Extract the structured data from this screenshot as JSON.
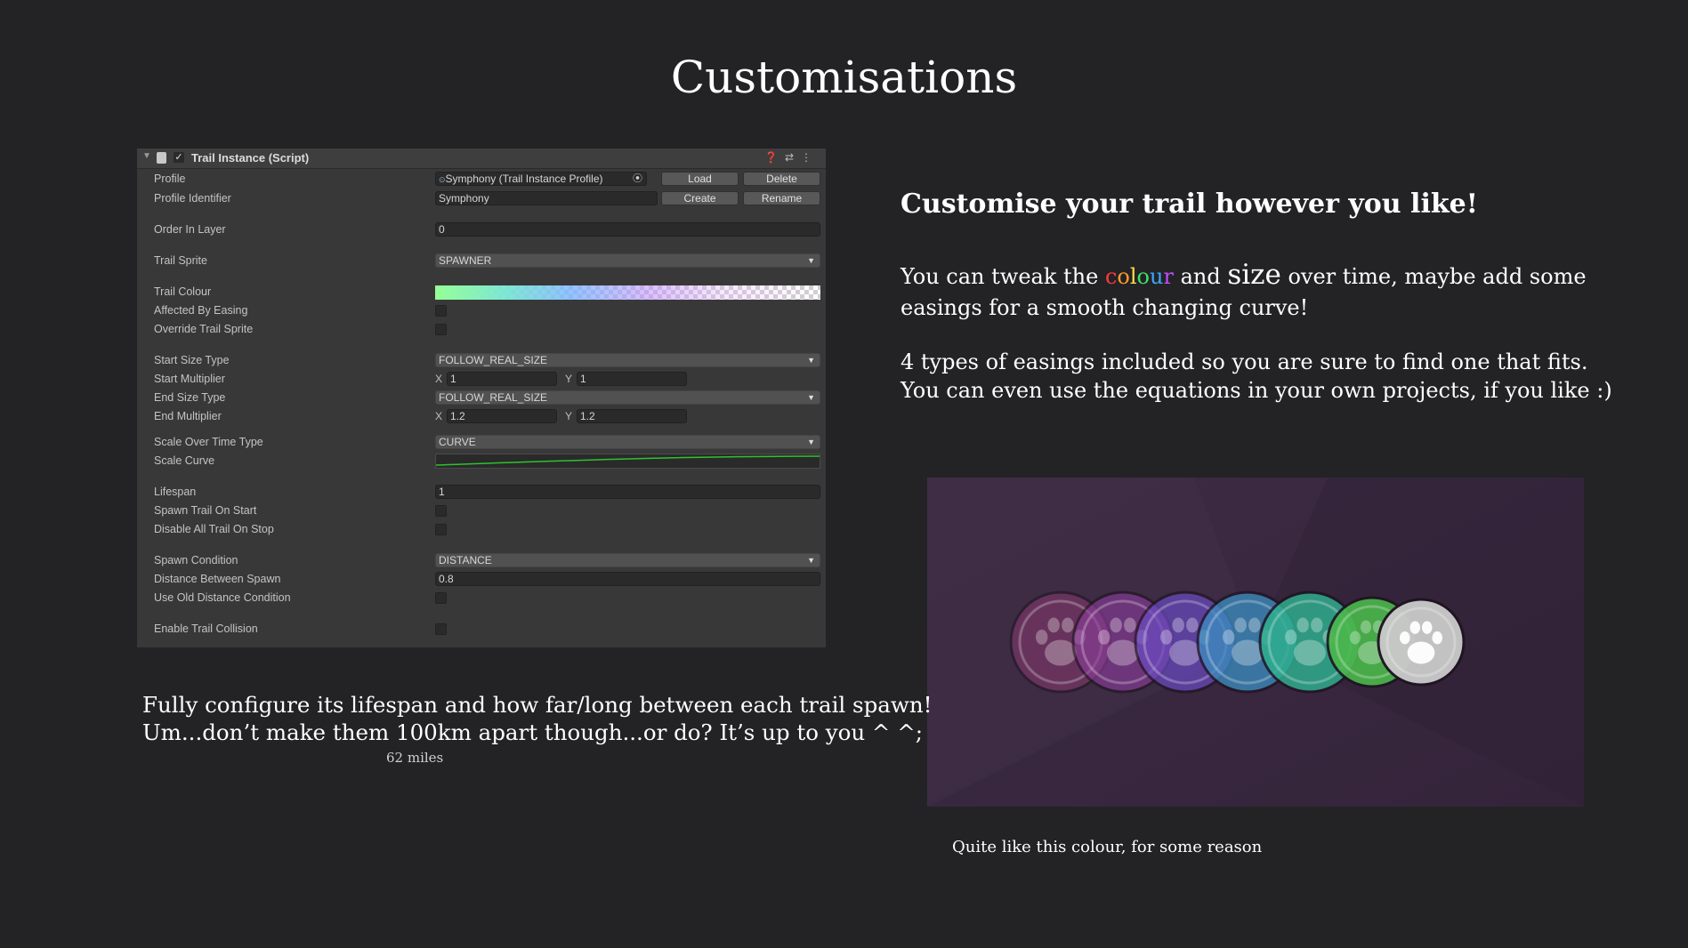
{
  "page": {
    "title": "Customisations"
  },
  "inspector": {
    "header": {
      "title": "Trail Instance (Script)"
    },
    "profile": {
      "label": "Profile",
      "value": "Symphony (Trail Instance Profile)",
      "load": "Load",
      "delete": "Delete"
    },
    "profile_identifier": {
      "label": "Profile Identifier",
      "value": "Symphony",
      "create": "Create",
      "rename": "Rename"
    },
    "order_in_layer": {
      "label": "Order In Layer",
      "value": "0"
    },
    "trail_sprite": {
      "label": "Trail Sprite",
      "value": "SPAWNER"
    },
    "trail_colour": {
      "label": "Trail Colour"
    },
    "affected_by_easing": {
      "label": "Affected By Easing"
    },
    "override_trail_sprite": {
      "label": "Override Trail Sprite"
    },
    "start_size_type": {
      "label": "Start Size Type",
      "value": "FOLLOW_REAL_SIZE"
    },
    "start_multiplier": {
      "label": "Start Multiplier",
      "x_label": "X",
      "x": "1",
      "y_label": "Y",
      "y": "1"
    },
    "end_size_type": {
      "label": "End Size Type",
      "value": "FOLLOW_REAL_SIZE"
    },
    "end_multiplier": {
      "label": "End Multiplier",
      "x_label": "X",
      "x": "1.2",
      "y_label": "Y",
      "y": "1.2"
    },
    "scale_over_time_type": {
      "label": "Scale Over Time Type",
      "value": "CURVE"
    },
    "scale_curve": {
      "label": "Scale Curve",
      "curve_color": "#2ec22e"
    },
    "lifespan": {
      "label": "Lifespan",
      "value": "1"
    },
    "spawn_trail_on_start": {
      "label": "Spawn Trail On Start"
    },
    "disable_all_trail_on_stop": {
      "label": "Disable All Trail On Stop"
    },
    "spawn_condition": {
      "label": "Spawn Condition",
      "value": "DISTANCE"
    },
    "distance_between_spawn": {
      "label": "Distance Between Spawn",
      "value": "0.8"
    },
    "use_old_distance_condition": {
      "label": "Use Old Distance Condition"
    },
    "enable_trail_collision": {
      "label": "Enable Trail Collision"
    }
  },
  "right": {
    "heading": "Customise your trail however you like!",
    "para1_before": "You can tweak the ",
    "colour_letters": [
      {
        "ch": "c",
        "color": "#ff3b3b"
      },
      {
        "ch": "o",
        "color": "#ff9a2e"
      },
      {
        "ch": "l",
        "color": "#ffe14a"
      },
      {
        "ch": "o",
        "color": "#3ee06a"
      },
      {
        "ch": "u",
        "color": "#3aa8ff"
      },
      {
        "ch": "r",
        "color": "#c04dff"
      }
    ],
    "para1_and": " and ",
    "para1_size": "size",
    "para1_after": " over time, maybe add some",
    "para1_line2": "easings for a smooth changing curve!",
    "para2_line1": "4 types of easings included so you are sure to find one that fits.",
    "para2_line2": "You can even use the equations in your own projects, if you like :)",
    "caption": "Quite like this colour, for some reason"
  },
  "left": {
    "line1": "Fully configure its lifespan and how far/long between each trail spawn!",
    "line2": "Um...don’t make them 100km apart though...or do? It’s up to you ^ ^;",
    "note": "62 miles"
  },
  "colors": {
    "background": "#232325",
    "game_bg": "#3b2a40",
    "paws": [
      "#8a3a70",
      "#8d3d9c",
      "#6b4bc4",
      "#3b8ec0",
      "#2fb08f",
      "#4bb84b",
      "#c8c8c8"
    ]
  }
}
